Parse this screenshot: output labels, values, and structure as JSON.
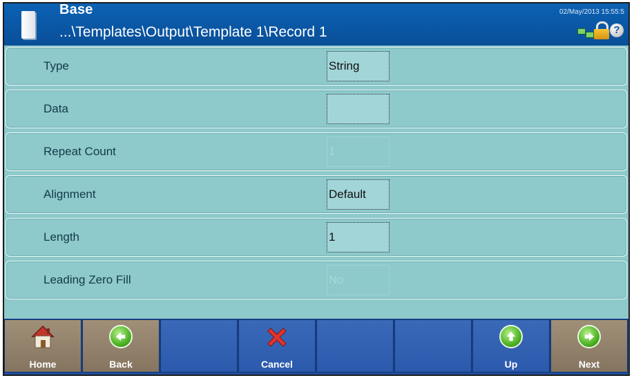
{
  "header": {
    "title": "Base",
    "path": "...\\Templates\\Output\\Template 1\\Record 1",
    "datetime": "02/May/2013 15:55:5",
    "icons": [
      "document-icon",
      "network-icon",
      "lock-icon",
      "help-icon"
    ],
    "help_glyph": "?"
  },
  "rows": [
    {
      "label": "Type",
      "value": "String",
      "state": "enabled"
    },
    {
      "label": "Data",
      "value": "",
      "state": "enabled"
    },
    {
      "label": "Repeat Count",
      "value": "1",
      "state": "disabled"
    },
    {
      "label": "Alignment",
      "value": "Default",
      "state": "enabled"
    },
    {
      "label": "Length",
      "value": "1",
      "state": "enabled"
    },
    {
      "label": "Leading Zero Fill",
      "value": "No",
      "state": "disabled"
    }
  ],
  "toolbar": {
    "home": "Home",
    "back": "Back",
    "cancel": "Cancel",
    "up": "Up",
    "next": "Next"
  },
  "colors": {
    "header_bg": "#0a56a3",
    "row_bg": "#8ec9cb",
    "toolbar_bg": "#1f4f9e",
    "toolbar_tan": "#857560"
  }
}
